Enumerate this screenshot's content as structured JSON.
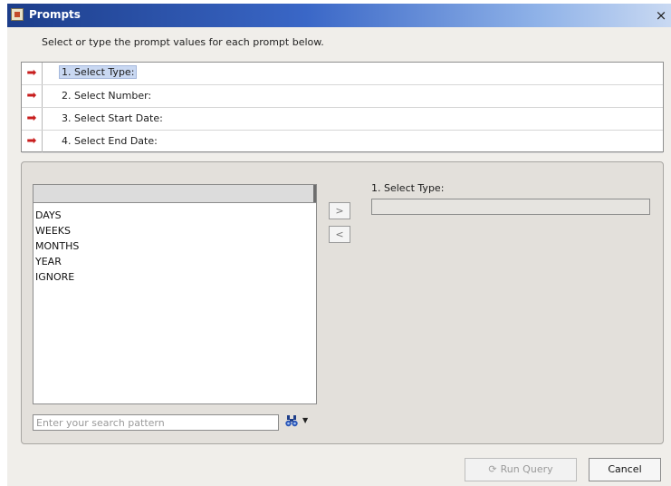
{
  "window": {
    "title": "Prompts",
    "close_glyph": "×"
  },
  "instructions": "Select or type the prompt values for each prompt below.",
  "prompts": [
    {
      "label": "1. Select Type:",
      "icon": "arrow-right-icon"
    },
    {
      "label": "2. Select Number:",
      "icon": "arrow-right-icon"
    },
    {
      "label": "3. Select Start Date:",
      "icon": "arrow-right-icon"
    },
    {
      "label": "4. Select End Date:",
      "icon": "arrow-right-icon"
    }
  ],
  "prompt_arrow_glyph": "➡",
  "prompt_arrow_color": "#c81e1e",
  "available_values": [
    "DAYS",
    "WEEKS",
    "MONTHS",
    "YEAR",
    "IGNORE"
  ],
  "move_buttons": {
    "add": ">",
    "remove": "<"
  },
  "selected_panel": {
    "label": "1. Select Type:",
    "value": ""
  },
  "search": {
    "placeholder": "Enter your search pattern",
    "value": "",
    "icon": "binoculars-icon",
    "dropdown_glyph": "▼"
  },
  "buttons": {
    "run_query": "Run Query",
    "run_query_icon": "refresh-icon",
    "cancel": "Cancel"
  }
}
